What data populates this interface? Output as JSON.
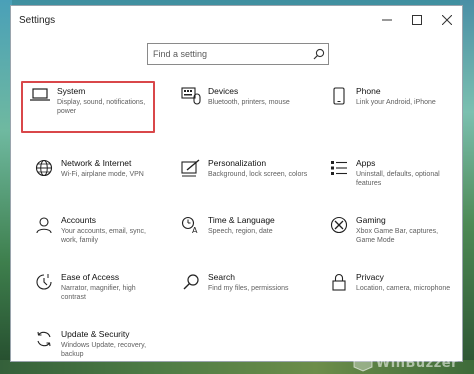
{
  "window": {
    "title": "Settings"
  },
  "caption": {
    "minimize": "—",
    "maximize": "☐",
    "close": "✕"
  },
  "search": {
    "placeholder": "Find a setting"
  },
  "categories": [
    {
      "title": "System",
      "desc": "Display, sound, notifications, power",
      "icon": "laptop-icon"
    },
    {
      "title": "Devices",
      "desc": "Bluetooth, printers, mouse",
      "icon": "keyboard-icon"
    },
    {
      "title": "Phone",
      "desc": "Link your Android, iPhone",
      "icon": "phone-icon"
    },
    {
      "title": "Network & Internet",
      "desc": "Wi-Fi, airplane mode, VPN",
      "icon": "globe-icon"
    },
    {
      "title": "Personalization",
      "desc": "Background, lock screen, colors",
      "icon": "paintbrush-icon"
    },
    {
      "title": "Apps",
      "desc": "Uninstall, defaults, optional features",
      "icon": "apps-list-icon"
    },
    {
      "title": "Accounts",
      "desc": "Your accounts, email, sync, work, family",
      "icon": "person-icon"
    },
    {
      "title": "Time & Language",
      "desc": "Speech, region, date",
      "icon": "time-language-icon"
    },
    {
      "title": "Gaming",
      "desc": "Xbox Game Bar, captures, Game Mode",
      "icon": "xbox-icon"
    },
    {
      "title": "Ease of Access",
      "desc": "Narrator, magnifier, high contrast",
      "icon": "ease-of-access-icon"
    },
    {
      "title": "Search",
      "desc": "Find my files, permissions",
      "icon": "search-icon"
    },
    {
      "title": "Privacy",
      "desc": "Location, camera, microphone",
      "icon": "lock-icon"
    },
    {
      "title": "Update & Security",
      "desc": "Windows Update, recovery, backup",
      "icon": "update-icon"
    }
  ],
  "selected_category": "System",
  "colors": {
    "accent": "#d9474a",
    "window_bg": "#ffffff"
  },
  "watermark": {
    "text": "WinBuzzer"
  }
}
